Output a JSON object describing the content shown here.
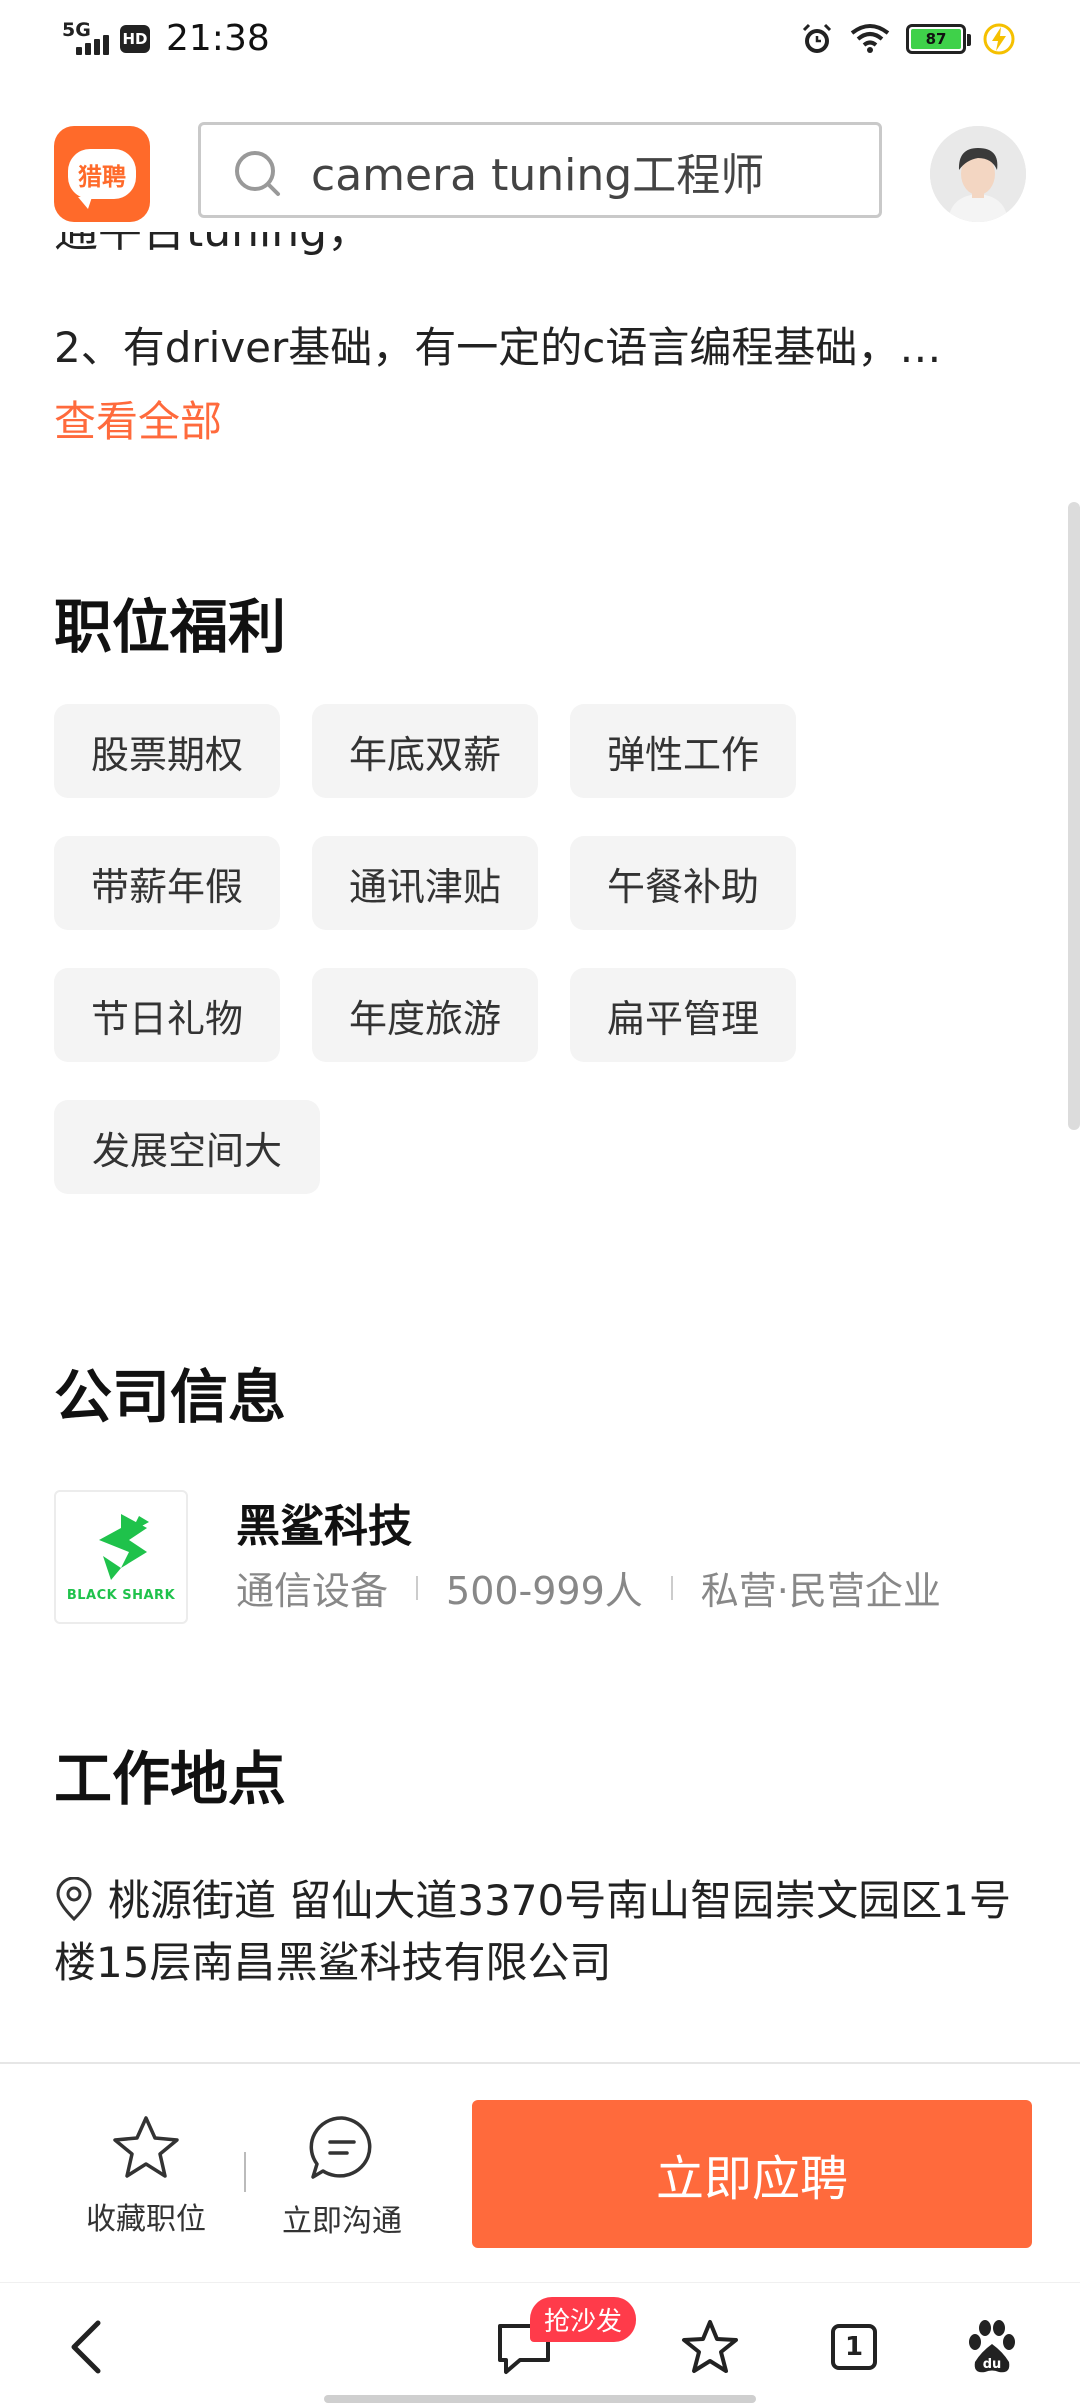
{
  "status_bar": {
    "network": "5G",
    "hd": "HD",
    "time": "21:38",
    "battery_level": "87",
    "colors": {
      "battery_fill": "#3fd14a",
      "charging": "#f5c000"
    }
  },
  "header": {
    "app_logo_text": "猎聘",
    "search_value": "camera tuning工程师",
    "brand_color": "#ff6a2a"
  },
  "job_description": {
    "cut_line": "通平台tuning，",
    "line": "2、有driver基础，有一定的c语言编程基础，…",
    "view_all": "查看全部"
  },
  "benefits": {
    "title": "职位福利",
    "tags": [
      "股票期权",
      "年底双薪",
      "弹性工作",
      "带薪年假",
      "通讯津贴",
      "午餐补助",
      "节日礼物",
      "年度旅游",
      "扁平管理",
      "发展空间大"
    ]
  },
  "company": {
    "title": "公司信息",
    "name": "黑鲨科技",
    "logo_text": "BLACK SHARK",
    "industry": "通信设备",
    "size": "500-999人",
    "type": "私营·民营企业"
  },
  "location": {
    "title": "工作地点",
    "address": "桃源街道 留仙大道3370号南山智园崇文园区1号楼15层南昌黑鲨科技有限公司"
  },
  "actions": {
    "favorite_label": "收藏职位",
    "chat_label": "立即沟通",
    "apply_label": "立即应聘",
    "apply_color": "#ff6a3c"
  },
  "browser_nav": {
    "hot_badge": "抢沙发",
    "tab_count": "1"
  }
}
